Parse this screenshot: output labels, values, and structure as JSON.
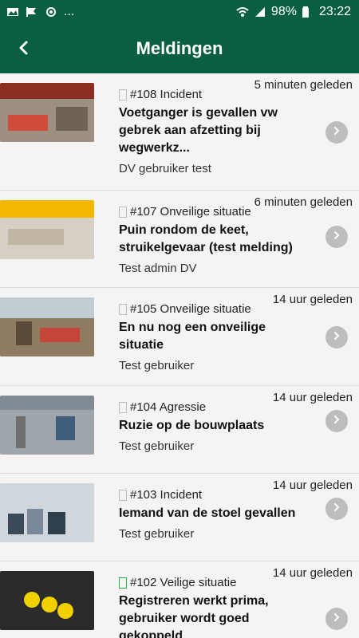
{
  "status": {
    "battery": "98%",
    "time": "23:22",
    "more": "..."
  },
  "header": {
    "title": "Meldingen"
  },
  "items": [
    {
      "time": "5 minuten geleden",
      "meta": "#108 Incident",
      "headline": "Voetganger is gevallen vw gebrek aan afzetting bij wegwerkz...",
      "author": "DV gebruiker test"
    },
    {
      "time": "6 minuten geleden",
      "meta": "#107 Onveilige situatie",
      "headline": "Puin rondom de keet, struikelgevaar (test melding)",
      "author": "Test admin DV"
    },
    {
      "time": "14 uur geleden",
      "meta": "#105 Onveilige situatie",
      "headline": "En nu nog een onveilige situatie",
      "author": "Test gebruiker"
    },
    {
      "time": "14 uur geleden",
      "meta": "#104 Agressie",
      "headline": "Ruzie op de bouwplaats",
      "author": "Test gebruiker"
    },
    {
      "time": "14 uur geleden",
      "meta": "#103 Incident",
      "headline": "Iemand van de stoel gevallen",
      "author": "Test gebruiker"
    },
    {
      "time": "14 uur geleden",
      "meta": "#102 Veilige situatie",
      "headline": "Registreren werkt prima, gebruiker wordt goed gekoppeld",
      "author": ""
    }
  ],
  "colors": {
    "header": "#0a5f43",
    "background": "#f2f2f2",
    "chevron": "#bdbdbd"
  }
}
